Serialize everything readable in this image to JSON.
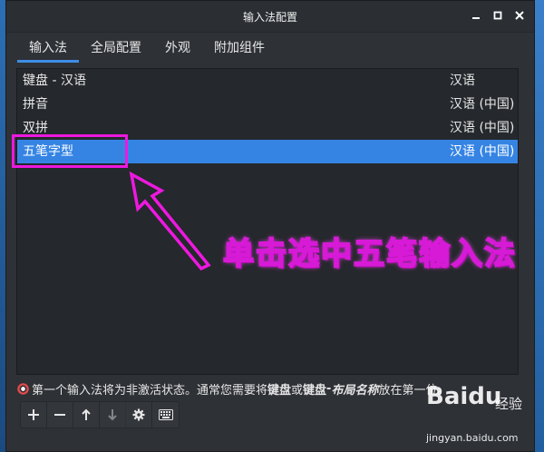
{
  "window": {
    "title": "输入法配置"
  },
  "tabs": [
    {
      "label": "输入法"
    },
    {
      "label": "全局配置"
    },
    {
      "label": "外观"
    },
    {
      "label": "附加组件"
    }
  ],
  "input_methods": [
    {
      "name": "键盘 - 汉语",
      "language": "汉语"
    },
    {
      "name": "拼音",
      "language": "汉语 (中国)"
    },
    {
      "name": "双拼",
      "language": "汉语 (中国)"
    },
    {
      "name": "五笔字型",
      "language": "汉语 (中国)",
      "selected": true
    }
  ],
  "annotation": {
    "text": "单击选中五笔输入法"
  },
  "info": {
    "pre": "第一个输入法将为非激活状态。通常您需要将",
    "k1": "键盘",
    "or": "或",
    "k2": "键盘",
    "dash": " - ",
    "k3": "布局名称",
    "post": "放在第一位。"
  },
  "watermark": {
    "logo": "Baidu",
    "jy": "经验",
    "url": "jingyan.baidu.com"
  },
  "colors": {
    "accent": "#3584e4",
    "highlight": "#ee18e0"
  }
}
